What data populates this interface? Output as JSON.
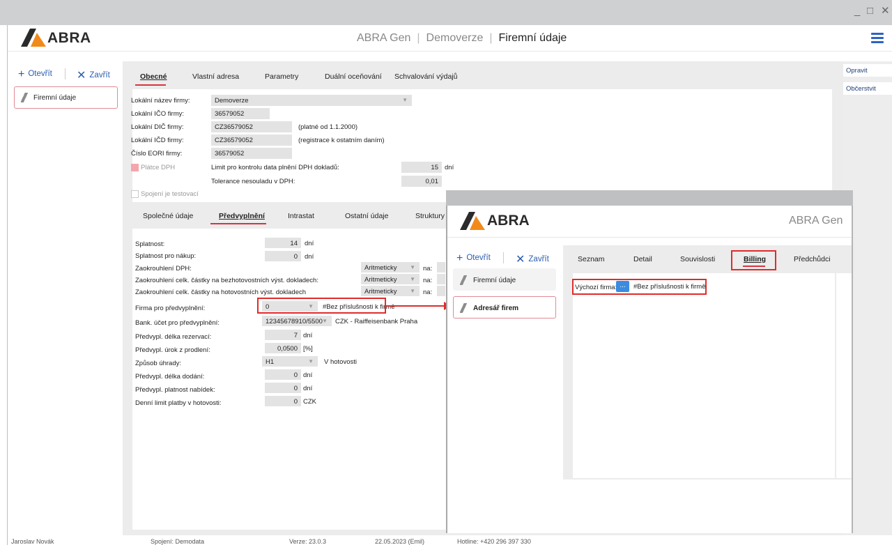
{
  "window": {
    "minimize": "_",
    "maximize": "□",
    "close": "✕"
  },
  "brand": {
    "logo_text": "ABRA"
  },
  "header": {
    "app": "ABRA Gen",
    "mode": "Demoverze",
    "agenda": "Firemní údaje"
  },
  "left_panel": {
    "open": "Otevřít",
    "close": "Zavřít",
    "items": [
      {
        "label": "Firemní údaje"
      }
    ]
  },
  "top_tabs": [
    "Obecné",
    "Vlastní adresa",
    "Parametry",
    "Duální oceňování",
    "Schvalování výdajů"
  ],
  "general": {
    "rows": [
      {
        "label": "Lokální název firmy:",
        "value": "Demoverze"
      },
      {
        "label": "Lokální IČO firmy:",
        "value": "36579052"
      },
      {
        "label": "Lokální DIČ firmy:",
        "value": "CZ36579052",
        "note": "(platné od 1.1.2000)"
      },
      {
        "label": "Lokální IČD firmy:",
        "value": "CZ36579052",
        "note": "(registrace k ostatním daním)"
      },
      {
        "label": "Číslo EORI firmy:",
        "value": "36579052"
      }
    ],
    "vat_payer": "Plátce DPH",
    "vat_date_limit_label": "Limit pro kontrolu data plnění DPH dokladů:",
    "vat_date_limit_value": "15",
    "vat_date_limit_unit": "dní",
    "vat_tolerance_label": "Tolerance nesouladu v DPH:",
    "vat_tolerance_value": "0,01",
    "test_connection": "Spojení je testovací"
  },
  "sub_tabs": [
    "Společné údaje",
    "Předvyplnění",
    "Intrastat",
    "Ostatní údaje",
    "Struktury"
  ],
  "prefill": {
    "splatnost": {
      "label": "Splatnost:",
      "value": "14",
      "unit": "dní"
    },
    "splatnost_nakup": {
      "label": "Splatnost pro nákup:",
      "value": "0",
      "unit": "dní"
    },
    "rounding": [
      {
        "label": "Zaokrouhlení DPH:",
        "value": "Aritmeticky",
        "na": "na:"
      },
      {
        "label": "Zaokrouhlení celk. částky na bezhotovostních výst. dokladech:",
        "value": "Aritmeticky",
        "na": "na:"
      },
      {
        "label": "Zaokrouhlení celk. částky na hotovostních výst. dokladech",
        "value": "Aritmeticky",
        "na": "na:"
      }
    ],
    "firm": {
      "label": "Firma pro předvyplnění:",
      "value": "0",
      "desc": "#Bez příslušnosti k firmě"
    },
    "bank": {
      "label": "Bank. účet pro předvyplnění:",
      "value": "12345678910/5500",
      "desc": "CZK - Raiffeisenbank Praha"
    },
    "reservation": {
      "label": "Předvypl. délka rezervací:",
      "value": "7",
      "unit": "dní"
    },
    "interest": {
      "label": "Předvypl. úrok z prodlení:",
      "value": "0,0500",
      "unit": "[%]"
    },
    "payment": {
      "label": "Způsob úhrady:",
      "value": "H1",
      "desc": "V hotovosti"
    },
    "delivery": {
      "label": "Předvypl. délka dodání:",
      "value": "0",
      "unit": "dní"
    },
    "offer_validity": {
      "label": "Předvypl. platnost nabídek:",
      "value": "0",
      "unit": "dní"
    },
    "cash_limit": {
      "label": "Denní limit platby v hotovosti:",
      "value": "0",
      "unit": "CZK"
    }
  },
  "right_buttons": {
    "edit": "Opravit",
    "refresh": "Občerstvit"
  },
  "overlay": {
    "logo_text": "ABRA",
    "app": "ABRA Gen",
    "open": "Otevřít",
    "close": "Zavřít",
    "items": [
      {
        "label": "Firemní údaje"
      },
      {
        "label": "Adresář firem"
      }
    ],
    "tabs": [
      "Seznam",
      "Detail",
      "Souvislosti",
      "Billing",
      "Předchůdci"
    ],
    "default_firm_label": "Výchozí firma:",
    "default_firm_button": "...",
    "default_firm_value": "#Bez příslušnosti k firmě"
  },
  "statusbar": {
    "user": "Jaroslav Novák",
    "connection": "Spojení: Demodata",
    "version": "Verze: 23.0.3",
    "date": "22.05.2023 (Emil)",
    "hotline": "Hotline: +420 296 397 330"
  },
  "colors": {
    "accent": "#e02b2b",
    "link": "#2a5db0",
    "logo_orange": "#f28a1b"
  }
}
